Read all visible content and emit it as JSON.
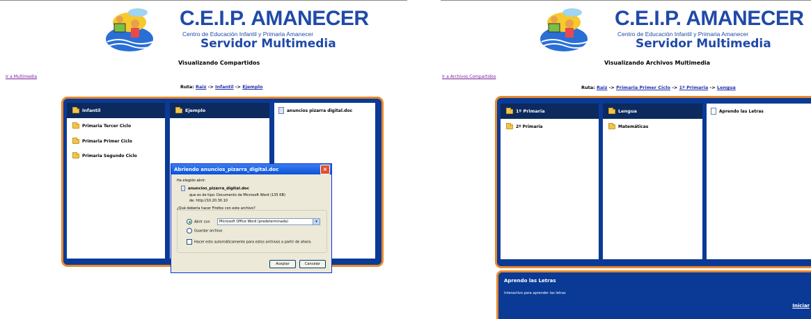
{
  "brand": {
    "title": "C.E.I.P. AMANECER",
    "subtitle": "Centro de Educación Infantil y Primaria Amanecer",
    "service": "Servidor Multimedia"
  },
  "left": {
    "heading": "Visualizando Compartidos",
    "side_link": "Ir a Multimedia",
    "ruta_label": "Ruta:",
    "ruta_sep": "->",
    "ruta": [
      "Raiz",
      "Infantil",
      "Ejemplo"
    ],
    "columns": [
      {
        "header": "Infantil",
        "items": [
          "Primaria Tercer Ciclo",
          "Primaria Primer Ciclo",
          "Primaria Segundo Ciclo"
        ]
      },
      {
        "header": "Ejemplo",
        "items": []
      },
      {
        "file": "anuncios pizarra digital.doc"
      }
    ],
    "dialog": {
      "title": "Abriendo anuncios_pizarra_digital.doc",
      "chosen_label": "Ha elegido abrir:",
      "filename": "anuncios_pizarra_digital.doc",
      "type_label": "que es de tipo:",
      "type_value": "Documento de Microsoft Word (135 KB)",
      "from_label": "de:",
      "from_value": "http://10.20.30.10",
      "question": "¿Qué debería hacer Firefox con este archivo?",
      "open_with_label": "Abrir con",
      "open_with_value": "Microsoft Office Word (predeterminada)",
      "save_label": "Guardar archivo",
      "auto_label": "Hacer esto automáticamente para estos archivos a partir de ahora.",
      "accept": "Aceptar",
      "cancel": "Cancelar"
    }
  },
  "right": {
    "heading": "Visualizando Archivos Multimedia",
    "side_link": "Ir a Archivos Compartidos",
    "ruta_label": "Ruta:",
    "ruta_sep": "->",
    "ruta": [
      "Raiz",
      "Primaria Primer Ciclo",
      "1º Primaria",
      "Lengua"
    ],
    "columns": [
      {
        "header": "1º Primaria",
        "items": [
          "2º Primaria"
        ]
      },
      {
        "header": "Lengua",
        "items": [
          "Matemáticas"
        ]
      },
      {
        "file": "Aprendo las Letras"
      }
    ],
    "info": {
      "title": "Aprendo las Letras",
      "description": "Interactivo para aprender las letras",
      "button": "Iniciar"
    }
  },
  "colors": {
    "brand_blue": "#1f4aa8",
    "browser_bg": "#0a3a96",
    "column_header": "#0d2a5e",
    "frame_orange": "#e8892c",
    "link_blue": "#1f2fa8",
    "visited_purple": "#7a1f9a"
  },
  "icons": [
    "school-logo-icon",
    "folder-icon",
    "document-icon",
    "word-document-icon",
    "close-icon",
    "chevron-down-icon"
  ]
}
